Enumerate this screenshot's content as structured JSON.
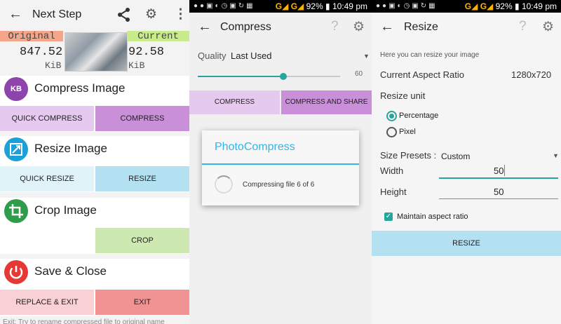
{
  "status_bar": {
    "battery": "92%",
    "time": "10:49 pm",
    "network_labels": [
      "G",
      "G"
    ],
    "notification_icons": [
      "whatsapp-icon",
      "messenger-icon",
      "image-icon",
      "recent-icon",
      "clock-icon",
      "image-icon",
      "sync-icon",
      "sd-card-icon"
    ]
  },
  "next_step": {
    "title": "Next Step",
    "original": {
      "label": "Original",
      "value": "847.52",
      "unit": "KiB"
    },
    "current": {
      "label": "Current",
      "value": "92.58",
      "unit": "KiB"
    },
    "compress": {
      "title": "Compress Image",
      "icon_text": "KB",
      "quick_label": "QUICK COMPRESS",
      "main_label": "COMPRESS"
    },
    "resize": {
      "title": "Resize Image",
      "quick_label": "QUICK RESIZE",
      "main_label": "RESIZE"
    },
    "crop": {
      "title": "Crop Image",
      "main_label": "CROP"
    },
    "save": {
      "title": "Save & Close",
      "replace_label": "REPLACE & EXIT",
      "exit_label": "EXIT"
    },
    "hint": "Exit: Try to rename compressed file to original name"
  },
  "compress_screen": {
    "title": "Compress",
    "quality_label": "Quality",
    "quality_value": "Last Used",
    "slider_value": "60",
    "slider_fraction": 0.6,
    "compress_label": "COMPRESS",
    "compress_share_label": "COMPRESS AND SHARE",
    "dialog": {
      "title": "PhotoCompress",
      "message": "Compressing file 6 of 6"
    }
  },
  "resize_screen": {
    "title": "Resize",
    "intro": "Here you can resize your image",
    "aspect_label": "Current Aspect Ratio",
    "aspect_value": "1280x720",
    "unit_label": "Resize unit",
    "unit_options": [
      "Percentage",
      "Pixel"
    ],
    "presets_label": "Size Presets :",
    "presets_value": "Custom",
    "width_label": "Width",
    "width_value": "50",
    "height_label": "Height",
    "height_value": "50",
    "maintain_label": "Maintain aspect ratio",
    "resize_label": "RESIZE"
  },
  "colors": {
    "teal": "#26a69a",
    "info_blue": "#33b5e5",
    "compress_purple": "#8e44ad",
    "resize_blue": "#1ba1d8",
    "crop_green": "#2e9c48",
    "save_red": "#e53935"
  }
}
